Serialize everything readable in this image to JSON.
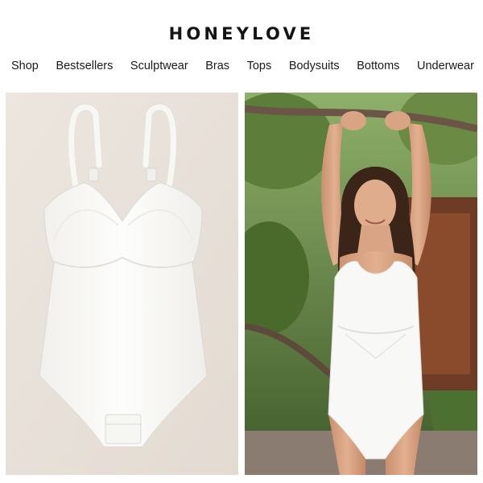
{
  "brand": {
    "logo_text": "HONEYLOVE"
  },
  "nav": {
    "items": [
      {
        "label": "Shop"
      },
      {
        "label": "Bestsellers"
      },
      {
        "label": "Sculptwear"
      },
      {
        "label": "Bras"
      },
      {
        "label": "Tops"
      },
      {
        "label": "Bodysuits"
      },
      {
        "label": "Bottoms"
      },
      {
        "label": "Underwear"
      }
    ]
  },
  "images": [
    {
      "name": "product-flat-lay-image",
      "subject": "white bodysuit flat lay"
    },
    {
      "name": "model-wearing-bodysuit-image",
      "subject": "model wearing white bodysuit outdoors"
    }
  ],
  "colors": {
    "background": "#ffffff",
    "text": "#1a1a1a",
    "flatlay_bg": "#e9e2db",
    "garment": "#fbfbf9"
  }
}
